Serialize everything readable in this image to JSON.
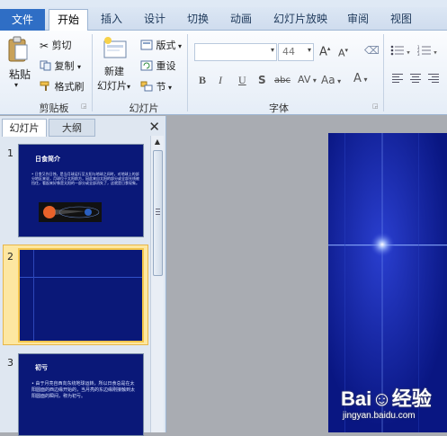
{
  "ribbon_tabs": [
    "文件",
    "开始",
    "插入",
    "设计",
    "切换",
    "动画",
    "幻灯片放映",
    "审阅",
    "视图"
  ],
  "clipboard": {
    "paste_label": "粘贴",
    "cut_label": "剪切",
    "copy_label": "复制",
    "format_painter_label": "格式刷",
    "group_label": "剪贴板"
  },
  "slides_group": {
    "new_slide_line1": "新建",
    "new_slide_line2": "幻灯片",
    "layout_label": "版式",
    "reset_label": "重设",
    "section_label": "节",
    "group_label": "幻灯片"
  },
  "font_group": {
    "font_name_value": "",
    "font_size_value": "44",
    "grow_label": "A",
    "shrink_label": "A",
    "bold": "B",
    "italic": "I",
    "underline": "U",
    "shadow": "S",
    "strike": "abc",
    "spacing": "AV",
    "case": "Aa",
    "color": "A",
    "group_label": "字体"
  },
  "panel": {
    "tab_slides": "幻灯片",
    "tab_outline": "大纲",
    "close": "✕"
  },
  "slides": [
    {
      "number": "1",
      "title": "日食简介",
      "body": "• 日食又作日蚀，是当月球运行至太阳与地球之间时，对地球上的部分地区来说，月球位于太阳前方，因此来自太阳的部分或全部光线被挡住，看起来好像是太阳的一部分或全部消失了，这就是日食现象。"
    },
    {
      "number": "2",
      "title": "",
      "body": ""
    },
    {
      "number": "3",
      "title": "初亏",
      "body": "• 由于月亮自西向东绕地球运转，所以日食总是在太阳圆面的西边缘开始的，当月亮的东边缘刚接触到太阳圆面的瞬间，称为初亏。"
    }
  ],
  "watermark": {
    "logo": "Bai☺经验",
    "url": "jingyan.baidu.com"
  },
  "colors": {
    "file_tab": "#2f6ec5",
    "slide_bg": "#0b1c8e",
    "selected_thumb": "#f4c64b"
  }
}
